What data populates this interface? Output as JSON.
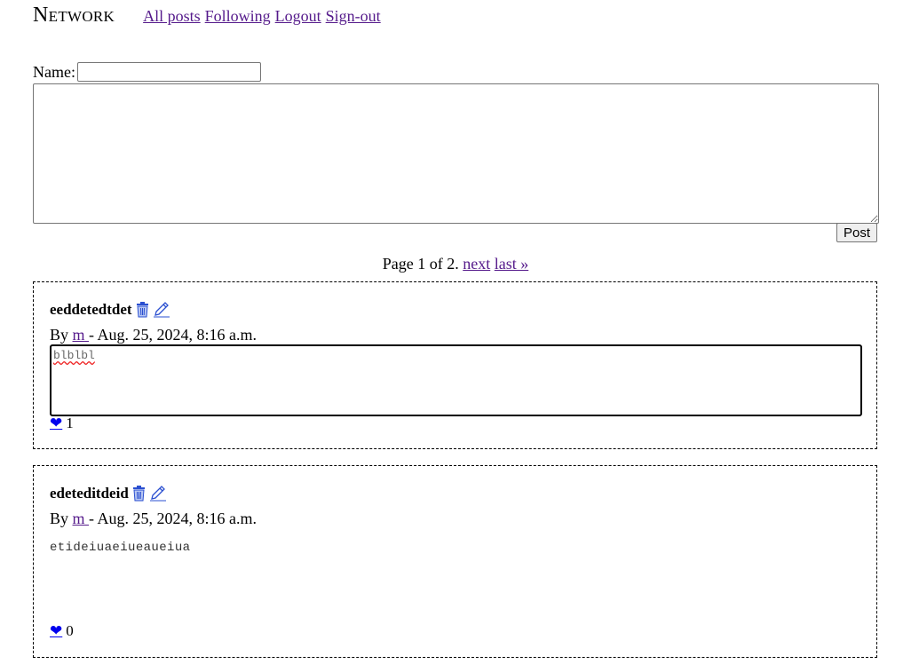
{
  "nav": {
    "brand": "Network",
    "links": [
      "All posts",
      "Following",
      "Logout",
      "Sign-out"
    ]
  },
  "compose": {
    "name_label": "Name:",
    "name_value": "",
    "body_value": "",
    "post_label": "Post"
  },
  "pagination": {
    "status": "Page 1 of 2.",
    "next_label": "next",
    "last_label": "last »"
  },
  "posts": [
    {
      "title": "eeddetedtdet",
      "by_label": "By",
      "author": "m",
      "date": "- Aug. 25, 2024, 8:16 a.m.",
      "edit_text": "blblbl",
      "likes": "1",
      "heart": "❤"
    },
    {
      "title": "edeteditdeid",
      "by_label": "By",
      "author": "m",
      "date": "- Aug. 25, 2024, 8:16 a.m.",
      "body": "etideiuaeiueaueiua",
      "likes": "0",
      "heart": "❤"
    }
  ],
  "icons": {
    "delete": "trash-icon",
    "edit": "pencil-icon"
  },
  "colors": {
    "link": "#551a8b",
    "action": "#0000ee"
  }
}
